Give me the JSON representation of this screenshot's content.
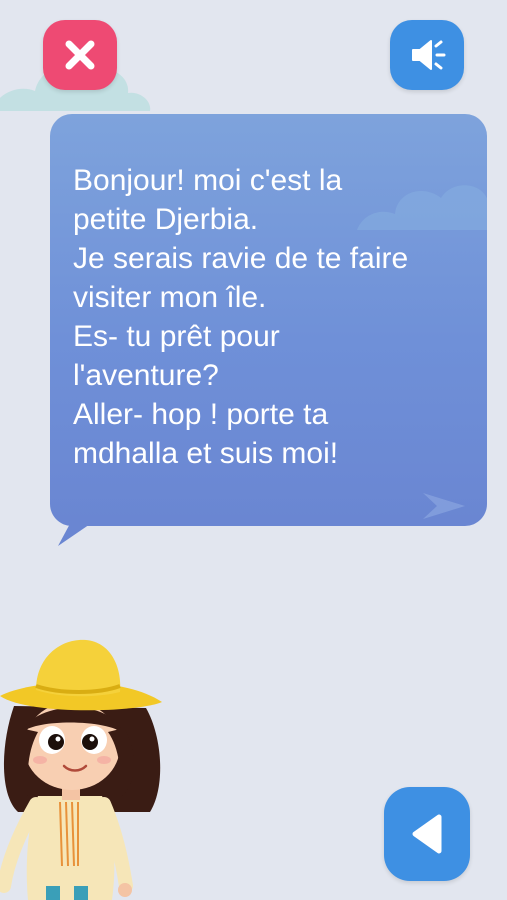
{
  "topbar": {
    "close_icon": "close-x-icon",
    "sound_icon": "speaker-icon"
  },
  "dialog": {
    "text": "Bonjour! moi c'est la\npetite Djerbia.\nJe serais ravie de te faire\nvisiter mon île.\nEs- tu prêt pour\nl'aventure?\nAller- hop ! porte ta\nmdhalla et suis moi!"
  },
  "colors": {
    "background": "#e2e6ef",
    "close_button": "#ee4a73",
    "blue_button": "#3e90e3",
    "bubble_top": "#7ea3dc",
    "bubble_bottom": "#6a86d2",
    "hat": "#f2c826"
  },
  "footer": {
    "back_icon": "triangle-left-icon"
  },
  "character": {
    "name": "girl-with-straw-hat"
  }
}
